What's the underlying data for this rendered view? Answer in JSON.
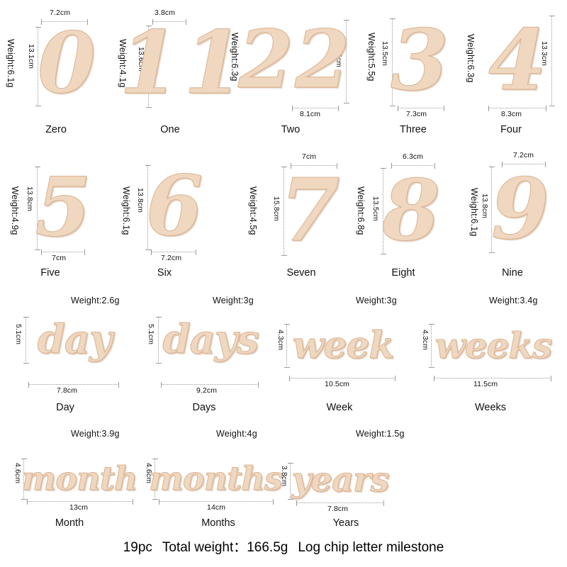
{
  "summary": {
    "pieces": "19pc",
    "total_weight_label": "Total weight：",
    "total_weight_value": "166.5g",
    "product_name": "Log chip letter milestone"
  },
  "colors": {
    "wood_fill": "#f0d7bf",
    "wood_edge": "#d9b494",
    "background": "#ffffff",
    "dimension_line": "#9a9a9a",
    "text": "#111111"
  },
  "items": [
    {
      "id": "zero",
      "name": "Zero",
      "glyph": "0",
      "width": "7.2cm",
      "height": "13.1cm",
      "weight": "Weight:6.1g"
    },
    {
      "id": "one",
      "name": "One",
      "glyph": "11",
      "width": "3.8cm",
      "height": "13.6cm",
      "weight": "Weight:4.1g"
    },
    {
      "id": "two",
      "name": "Two",
      "glyph": "22",
      "width": "8.1cm",
      "height": "13.5cm",
      "weight": "Weight:6.3g"
    },
    {
      "id": "three",
      "name": "Three",
      "glyph": "3",
      "width": "7.3cm",
      "height": "13.5cm",
      "weight": "Weight:5.5g"
    },
    {
      "id": "four",
      "name": "Four",
      "glyph": "4",
      "width": "8.3cm",
      "height": "13.3cm",
      "weight": "Weight:6.3g"
    },
    {
      "id": "five",
      "name": "Five",
      "glyph": "5",
      "width": "7cm",
      "height": "13.8cm",
      "weight": "Weight:4.9g"
    },
    {
      "id": "six",
      "name": "Six",
      "glyph": "6",
      "width": "7.2cm",
      "height": "13.8cm",
      "weight": "Weight:6.1g"
    },
    {
      "id": "seven",
      "name": "Seven",
      "glyph": "7",
      "width": "7cm",
      "height": "15.8cm",
      "weight": "Weight:4.5g"
    },
    {
      "id": "eight",
      "name": "Eight",
      "glyph": "8",
      "width": "6.3cm",
      "height": "13.5cm",
      "weight": "Weight:6.8g"
    },
    {
      "id": "nine",
      "name": "Nine",
      "glyph": "9",
      "width": "7.2cm",
      "height": "13.8cm",
      "weight": "Weight:6.1g"
    },
    {
      "id": "day",
      "name": "Day",
      "glyph": "day",
      "width": "7.8cm",
      "height": "5.1cm",
      "weight": "Weight:2.6g"
    },
    {
      "id": "days",
      "name": "Days",
      "glyph": "days",
      "width": "9.2cm",
      "height": "5.1cm",
      "weight": "Weight:3g"
    },
    {
      "id": "week",
      "name": "Week",
      "glyph": "week",
      "width": "10.5cm",
      "height": "4.3cm",
      "weight": "Weight:3g"
    },
    {
      "id": "weeks",
      "name": "Weeks",
      "glyph": "weeks",
      "width": "11.5cm",
      "height": "4.3cm",
      "weight": "Weight:3.4g"
    },
    {
      "id": "month",
      "name": "Month",
      "glyph": "month",
      "width": "13cm",
      "height": "4.6cm",
      "weight": "Weight:3.9g"
    },
    {
      "id": "months",
      "name": "Months",
      "glyph": "months",
      "width": "14cm",
      "height": "4.6cm",
      "weight": "Weight:4g"
    },
    {
      "id": "years",
      "name": "Years",
      "glyph": "years",
      "width": "7.8cm",
      "height": "3.8cm",
      "weight": "Weight:1.5g"
    }
  ]
}
